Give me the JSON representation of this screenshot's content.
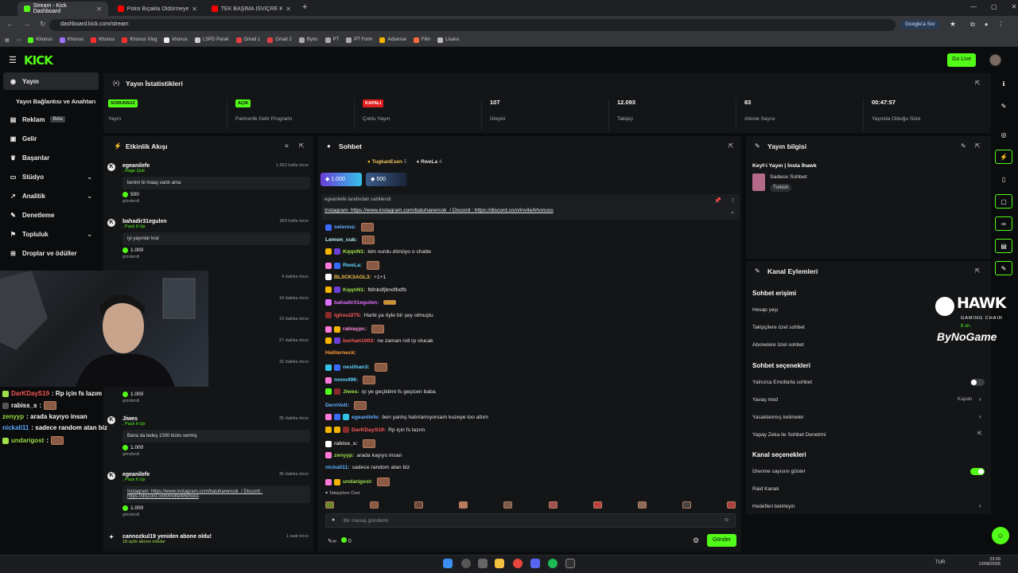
{
  "browser": {
    "tabs": [
      {
        "label": "Stream - Kick Dashboard"
      },
      {
        "label": "Polisi Bıçakla Öldürmeye Çalıştı..."
      },
      {
        "label": "TEK BAŞIMA İSVİÇRE KÖYLERİN..."
      }
    ],
    "url": "dashboard.kick.com/stream",
    "google_sor": "Google'a Sor",
    "bookmarks": [
      "Khonus",
      "Khonus",
      "Khonus",
      "Khonus Vlog",
      "khonus",
      "LSPD Panel",
      "Gmail 1",
      "Gmail 2",
      "Byno",
      "PT",
      "PT Form",
      "Adsense",
      "Film",
      "Lisans"
    ]
  },
  "header": {
    "logo": "KICK",
    "go_live": "Go Live",
    "colors": {
      "accent": "#53fc18",
      "bg": "#0b0c0d",
      "panel": "#141517"
    }
  },
  "sidebar": {
    "items": [
      {
        "label": "Yayın",
        "icon": "broadcast-icon"
      },
      {
        "label": "Yayın Bağlantısı ve Anahtarı",
        "icon": ""
      },
      {
        "label": "Reklam",
        "icon": "ad-icon",
        "badge": "Beta"
      },
      {
        "label": "Gelir",
        "icon": "wallet-icon"
      },
      {
        "label": "Başarılar",
        "icon": "trophy-icon"
      },
      {
        "label": "Stüdyo",
        "icon": "studio-icon"
      },
      {
        "label": "Analitik",
        "icon": "chart-icon"
      },
      {
        "label": "Denetleme",
        "icon": "wrench-icon"
      },
      {
        "label": "Topluluk",
        "icon": "community-icon"
      },
      {
        "label": "Droplar ve ödüller",
        "icon": "gift-icon"
      }
    ]
  },
  "stats": {
    "title": "Yayın İstatistikleri",
    "cells": [
      {
        "badge": "SORUNSUZ",
        "label": "Yayın",
        "badge_color": "#53fc18"
      },
      {
        "badge": "AÇIK",
        "label": "Partnerlik Gelir Programı",
        "badge_color": "#53fc18"
      },
      {
        "badge": "KAPALI",
        "label": "Çoklu Yayın",
        "badge_color": "#e01e1e"
      },
      {
        "value": "107",
        "label": "İzleyici"
      },
      {
        "value": "12.093",
        "label": "Takipçi"
      },
      {
        "value": "83",
        "label": "Abone Sayısı"
      },
      {
        "value": "00:47:57",
        "label": "Yayında Olduğu Süre"
      }
    ]
  },
  "events": {
    "title": "Etkinlik Akışı",
    "items": [
      {
        "name": "egeanilefe",
        "sub": ", Rage Quit",
        "time": "1.962 hafta önce",
        "msg": "benim bi maaş vardı ama",
        "kicks": "500",
        "sent": "gönderdi"
      },
      {
        "name": "bahadir31egulen",
        "sub": ", Pack It Up",
        "time": "969 hafta önce",
        "msg": "iyi yayınlar kral",
        "kicks": "1.000",
        "sent": "gönderdi"
      },
      {
        "name": "",
        "sub": "",
        "time": "4 dakika önce",
        "msg": "",
        "kicks": "",
        "sent": ""
      },
      {
        "name": "",
        "sub": "",
        "time": "18 dakika önce",
        "msg": "",
        "kicks": "",
        "sent": ""
      },
      {
        "name": "",
        "sub": "",
        "time": "19 dakika önce",
        "msg": "",
        "kicks": "",
        "sent": ""
      },
      {
        "name": "",
        "sub": "",
        "time": "27 dakika önce",
        "msg": "",
        "kicks": "",
        "sent": ""
      },
      {
        "name": "",
        "sub": "",
        "time": "32 dakika önce",
        "msg": "",
        "kicks": "1.000",
        "sent": "gönderdi"
      },
      {
        "name": "Jiwes",
        "sub": ", Pack It Up",
        "time": "35 dakika önce",
        "msg": "Bana da beleş 1000 kicks vermiş",
        "kicks": "1.000",
        "sent": "gönderdi"
      },
      {
        "name": "egeanilefe",
        "sub": ", Pack It Up",
        "time": "36 dakika önce",
        "msg": "Instagram: https://www.instagram.com/batuhanercok_/ Discord : https://discord.com/invite/khonuss",
        "kicks": "1.000",
        "sent": "gönderdi"
      },
      {
        "name": "cannozkul19 yeniden abone oldu!",
        "sub": "18 aylık abone oldular",
        "time": "1 saat önce",
        "msg": "",
        "kicks": "",
        "sent": ""
      }
    ]
  },
  "chat": {
    "title": "Sohbet",
    "top_gifters": [
      {
        "name": "TugkanEsen",
        "n": "5"
      },
      {
        "name": "RweLa",
        "n": "4"
      }
    ],
    "kick_pills": [
      "1.000",
      "500"
    ],
    "pinned_by": "egeanilefe tarafından sabitlendi",
    "pinned_msg": "Instagram: https://www.instagram.com/batuhanercok_/ Discord : https://discord.com/invite/khonuss",
    "messages": [
      {
        "user": "selenna:",
        "text": "",
        "color": "#5fb0ff"
      },
      {
        "user": "Lemon_cuk:",
        "text": "",
        "color": "#b9f5ff"
      },
      {
        "user": "KqqnN1:",
        "text": "kim vurdu dönüyo o chatte",
        "color": "#9fe04a"
      },
      {
        "user": "RweLa:",
        "text": "",
        "color": "#5fd5ff"
      },
      {
        "user": "BL3CK3AGL3:",
        "text": "+1+1",
        "color": "#f0c04a"
      },
      {
        "user": "KqqnN1:",
        "text": "fbfnbdfjbndfbdfb",
        "color": "#9fe04a"
      },
      {
        "user": "bahadir31egulen:",
        "text": "",
        "color": "#e070ff"
      },
      {
        "user": "tghoul275:",
        "text": "Harbi ya öyle bir şey olmuştu",
        "color": "#ff5a5a"
      },
      {
        "user": "rabiaypc:",
        "text": "",
        "color": "#ff8ad8"
      },
      {
        "user": "burhan1003:",
        "text": "ne zaman roll rp olucak",
        "color": "#ff5a5a"
      },
      {
        "user": "Haliterneck:",
        "text": "",
        "color": "#ff9a3c"
      },
      {
        "user": "neslihan3:",
        "text": "",
        "color": "#5fd5ff"
      },
      {
        "user": "nono496:",
        "text": "",
        "color": "#5fd5ff"
      },
      {
        "user": "Jiwes:",
        "text": "rp ye geçildimi fs geçicen baba",
        "color": "#9fe04a"
      },
      {
        "user": "DernVolt:",
        "text": "",
        "color": "#5fb0ff"
      },
      {
        "user": "egeanilefe:",
        "text": "ben yanlış hatırlamıyorsam kuzeye too attım",
        "color": "#5fb0ff"
      },
      {
        "user": "DarKDayS19:",
        "text": "Rp için fs lazım",
        "color": "#ff5a5a"
      },
      {
        "user": "rabiss_s:",
        "text": "",
        "color": "#cccccc"
      },
      {
        "user": "zenyyp:",
        "text": "arada kayıyo insan",
        "color": "#9fe04a"
      },
      {
        "user": "nickali11:",
        "text": "sadece random atan biz",
        "color": "#5fb0ff"
      },
      {
        "user": "undarigost:",
        "text": "",
        "color": "#9fe04a"
      }
    ],
    "followers_only": "Takipçilere Özel",
    "placeholder": "Bir mesaj gönderin",
    "counter_a": "∞",
    "counter_b": "0",
    "send": "Gönder"
  },
  "stream_info": {
    "title": "Yayın bilgisi",
    "stream_title": "Keyf-i Yayın | İnsta İhawk",
    "category": "Sadece Sohbet",
    "tag": "Turkish"
  },
  "channel_actions": {
    "title": "Kanal Eylemleri",
    "chat_access_header": "Sohbet erişimi",
    "chat_access": [
      {
        "label": "Hesap yaşı",
        "value": ""
      },
      {
        "label": "Takipçilere özel sohbet",
        "value": "6 sn."
      },
      {
        "label": "Abonelere özel sohbet",
        "value": ""
      }
    ],
    "chat_options_header": "Sohbet seçenekleri",
    "chat_options": [
      {
        "label": "Yalnızca Emotlarla sohbet",
        "value": ""
      },
      {
        "label": "Yavaş mod",
        "value": "Kapalı"
      },
      {
        "label": "Yasaklanmış kelimeler",
        "value": ""
      },
      {
        "label": "Yapay Zeka ile Sohbet Denetimi",
        "value": ""
      }
    ],
    "channel_options_header": "Kanal seçenekleri",
    "channel_options": [
      {
        "label": "İzlenme sayısını göster",
        "value": ""
      },
      {
        "label": "Raid Kanalı",
        "value": ""
      },
      {
        "label": "Hedefleri belirleyin",
        "value": ""
      }
    ]
  },
  "overlay": {
    "brand_big": "HAWK",
    "brand_small": "GAMING CHAIR",
    "brand_byno": "ByNoGame",
    "chat": [
      {
        "user": "DarKDayS19",
        "text": ": Rp için fs lazım",
        "color": "#ff5a5a"
      },
      {
        "user": "rabiss_s",
        "text": ":",
        "color": "#ffffff"
      },
      {
        "user": "zenyyp",
        "text": ": arada kayıyo insan",
        "color": "#9fe04a"
      },
      {
        "user": "nickali11",
        "text": ": sadece random atan biz",
        "color": "#5fb0ff"
      },
      {
        "user": "undarigost",
        "text": ":",
        "color": "#9fe04a"
      }
    ]
  },
  "taskbar": {
    "lang": "TUR",
    "time": "23:09",
    "date": "13/08/2026"
  }
}
